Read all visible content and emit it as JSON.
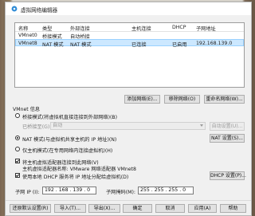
{
  "window": {
    "title": "虚拟网络编辑器"
  },
  "table": {
    "headers": [
      "名称",
      "类型",
      "外部连接",
      "主机连接",
      "DHCP",
      "子网地址"
    ],
    "rows": [
      {
        "name": "VMnet0",
        "type": "桥接模式",
        "external": "自动桥接",
        "host": "",
        "dhcp": "",
        "subnet": "",
        "selected": false
      },
      {
        "name": "VMnet8",
        "type": "NAT 模式",
        "external": "NAT 模式",
        "host": "已连接",
        "dhcp": "已启用",
        "subnet": "192.168.139.0",
        "selected": true
      }
    ]
  },
  "table_buttons": {
    "add": "添加网络(E)...",
    "remove": "移除网络(O)",
    "rename": "重命名网络(W)..."
  },
  "info": {
    "group_label": "VMnet 信息",
    "bridged_label": "桥接模式(将虚拟机直接连接到外部网络)(B)",
    "bridged_to_label": "已桥接至(G):",
    "bridged_to_value": "自动",
    "auto_settings": "自动设置(U)...",
    "nat_label": "NAT 模式(与虚拟机共享主机的 IP 地址)(N)",
    "nat_settings": "NAT 设置(S)...",
    "hostonly_label": "仅主机模式(在专用网络内连接虚拟机)(H)",
    "connect_adapter_label": "将主机虚拟适配器连接到此网络(V)",
    "adapter_name_line": "主机虚拟适配器名称: VMware 网络适配器 VMnet8",
    "dhcp_label": "使用本地 DHCP 服务将 IP 地址分配给虚拟机(D)",
    "dhcp_settings": "DHCP 设置(P)...",
    "subnet_ip_label": "子网 IP (I):",
    "subnet_ip_value": "192 . 168 . 139 . 0",
    "subnet_mask_label": "子网掩码(M):",
    "subnet_mask_value": "255 . 255 . 255 . 0"
  },
  "state": {
    "mode": "nat",
    "connect_adapter": true,
    "dhcp": true
  },
  "footer": {
    "restore": "还原默认设置(R)",
    "import": "导入(T)...",
    "export": "导出(X)...",
    "ok": "确定",
    "cancel": "取消",
    "apply": "应用(A)",
    "help": "帮助"
  }
}
